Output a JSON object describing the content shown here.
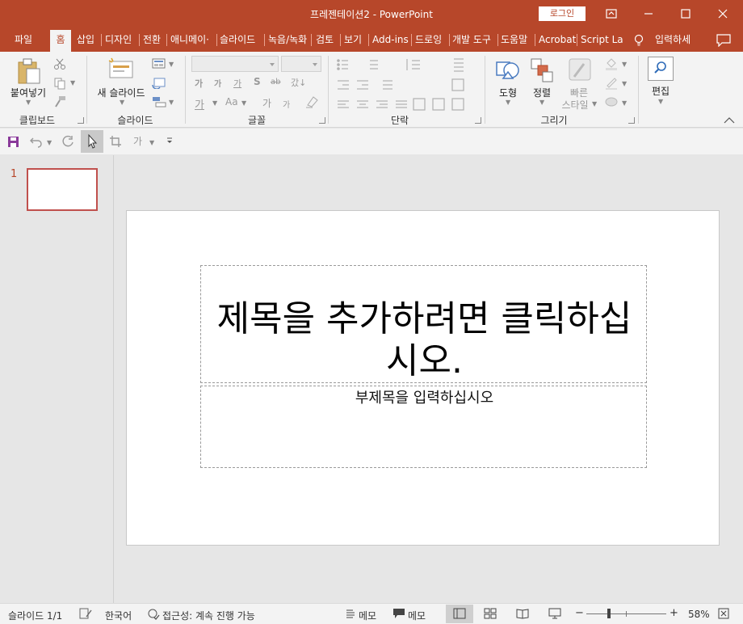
{
  "window": {
    "title": "프레젠테이션2  -  PowerPoint",
    "login_label": "로그인",
    "accent": "#b7472a"
  },
  "tabs": [
    {
      "label": "파일"
    },
    {
      "label": "홈",
      "active": true
    },
    {
      "label": "삽입"
    },
    {
      "label": "디자인"
    },
    {
      "label": "전환"
    },
    {
      "label": "애니메이·"
    },
    {
      "label": "슬라이드"
    },
    {
      "label": "녹음/녹화"
    },
    {
      "label": "검토"
    },
    {
      "label": "보기"
    },
    {
      "label": "Add-ins"
    },
    {
      "label": "드로잉"
    },
    {
      "label": "개발 도구"
    },
    {
      "label": "도움말"
    },
    {
      "label": "Acrobat"
    },
    {
      "label": "Script Lab"
    }
  ],
  "tell_me": "입력하세",
  "ribbon": {
    "clipboard": {
      "group_label": "클립보드",
      "paste_label": "붙여넣기"
    },
    "slides": {
      "group_label": "슬라이드",
      "new_slide_label": "새 슬라이드"
    },
    "font": {
      "group_label": "글꼴",
      "font_glyphs": [
        "가",
        "가",
        "가",
        "S",
        "ab",
        "갔↓",
        "가",
        "Aa",
        "가",
        "가"
      ]
    },
    "paragraph": {
      "group_label": "단락"
    },
    "drawing": {
      "group_label": "그리기",
      "shapes_label": "도형",
      "arrange_label": "정렬",
      "quick_styles_label_1": "빠른",
      "quick_styles_label_2": "스타일"
    },
    "editing": {
      "label": "편집"
    }
  },
  "qat": {
    "text_glyph": "가"
  },
  "thumbnails": [
    {
      "number": "1"
    }
  ],
  "slide": {
    "title_placeholder": "제목을 추가하려면 클릭하십시오.",
    "subtitle_placeholder": "부제목을 입력하십시오"
  },
  "status": {
    "slide_count": "슬라이드 1/1",
    "language": "한국어",
    "accessibility": "접근성: 계속 진행 가능",
    "notes_label": "메모",
    "comments_label": "메모",
    "zoom": "58%"
  }
}
